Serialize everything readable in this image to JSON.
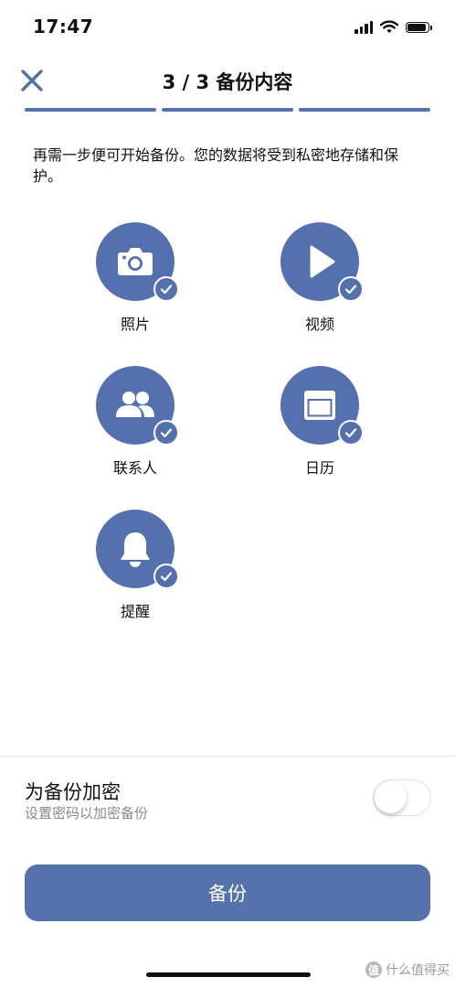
{
  "status_bar": {
    "time": "17:47",
    "battery_level": 0.9,
    "icons": [
      "signal-icon",
      "wifi-icon",
      "battery-icon"
    ]
  },
  "header": {
    "title": "3 / 3 备份内容",
    "close_icon": "close-icon",
    "steps_total": 3,
    "steps_completed": 3
  },
  "intro": {
    "text": "再需一步便可开始备份。您的数据将受到私密地存储和保护。"
  },
  "categories": [
    {
      "label": "照片",
      "icon": "camera-icon",
      "checked": true
    },
    {
      "label": "视频",
      "icon": "play-icon",
      "checked": true
    },
    {
      "label": "联系人",
      "icon": "contacts-icon",
      "checked": true
    },
    {
      "label": "日历",
      "icon": "calendar-icon",
      "checked": true
    },
    {
      "label": "提醒",
      "icon": "bell-icon",
      "checked": true
    }
  ],
  "encryption": {
    "title": "为备份加密",
    "subtitle": "设置密码以加密备份",
    "enabled": false
  },
  "backup_button": {
    "label": "备份"
  },
  "watermark": {
    "badge": "值",
    "text": "什么值得买"
  },
  "colors": {
    "accent": "#5470ae",
    "button": "#5473ad",
    "text": "#111111",
    "subtext": "#8a8a8a"
  }
}
